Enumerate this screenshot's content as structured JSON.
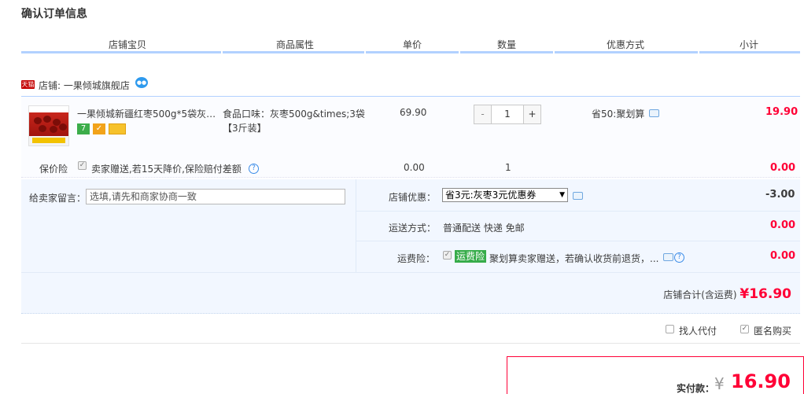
{
  "page_title": "确认订单信息",
  "table_headers": [
    "店铺宝贝",
    "商品属性",
    "单价",
    "数量",
    "优惠方式",
    "小计"
  ],
  "shop": {
    "badge": "天猫",
    "label": "店铺: 一果倾城旗舰店"
  },
  "item": {
    "title": "一果倾城新疆红枣500g*5袋灰…",
    "sku_line1": "食品口味：灰枣500g&times;3袋",
    "sku_line2": "【3斤装】",
    "price": "69.90",
    "quantity": "1",
    "minus": "-",
    "plus": "+",
    "promo": "省50:聚划算",
    "subtotal": "19.90"
  },
  "insurance": {
    "label": "保价险",
    "text": "卖家赠送,若15天降价,保险赔付差额",
    "price": "0.00",
    "qty": "1",
    "amount": "0.00"
  },
  "message": {
    "label": "给卖家留言：",
    "placeholder": "选填,请先和商家协商一致"
  },
  "shop_discount": {
    "label": "店铺优惠：",
    "selected": "省3元:灰枣3元优惠券",
    "amount": "-3.00"
  },
  "shipping": {
    "label": "运送方式：",
    "value": "普通配送 快递 免邮",
    "amount": "0.00"
  },
  "freight_insurance": {
    "label": "运费险：",
    "tag": "运费险",
    "text": "聚划算卖家赠送，若确认收货前退货，...",
    "amount": "0.00"
  },
  "shop_total": {
    "label": "店铺合计(含运费)",
    "amount": "¥16.90"
  },
  "options": {
    "pay_for_me": "找人代付",
    "anonymous": "匿名购买"
  },
  "payment": {
    "label": "实付款：",
    "yen": "¥",
    "amount": "16.90"
  },
  "colors": {
    "accent_red": "#ff0036",
    "header_rule": "#b2d1ff",
    "panel_bg": "#f2f7ff"
  }
}
